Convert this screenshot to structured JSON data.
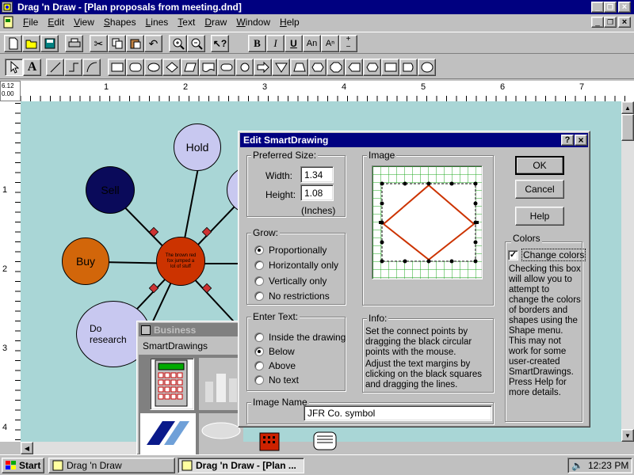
{
  "app_window": {
    "title": "Drag 'n Draw - [Plan proposals from meeting.dnd]"
  },
  "menu": [
    "File",
    "Edit",
    "View",
    "Shapes",
    "Lines",
    "Text",
    "Draw",
    "Window",
    "Help"
  ],
  "text_toolbar": {
    "bold": "B",
    "italic": "I",
    "underline": "U",
    "subscript": "An",
    "superscript": "Aⁿ",
    "plus": "+",
    "minus": "−"
  },
  "ruler": {
    "corner_top": "6.12",
    "corner_bottom": "0.00",
    "h_marks": [
      "1",
      "2",
      "3",
      "4",
      "5",
      "6",
      "7"
    ],
    "v_marks": [
      "1",
      "2",
      "3",
      "4"
    ]
  },
  "diagram": {
    "nodes": [
      {
        "label": "Hold",
        "color": "#c8c8f0"
      },
      {
        "label": "Sell",
        "color": "#0a0a5a"
      },
      {
        "label": "Buy",
        "color": "#d2660a"
      },
      {
        "label": "Do\nresearch",
        "color": "#c8c8f0"
      },
      {
        "label": "The brown red fox jumped a lot of stuff",
        "color": "#cc3300"
      }
    ]
  },
  "dialog": {
    "title": "Edit SmartDrawing",
    "help_glyph": "?",
    "close_glyph": "×",
    "preferred_size": {
      "label": "Preferred Size:",
      "width_label": "Width:",
      "width_value": "1.34",
      "height_label": "Height:",
      "height_value": "1.08",
      "units": "(Inches)"
    },
    "grow": {
      "label": "Grow:",
      "options": [
        "Proportionally",
        "Horizontally only",
        "Vertically only",
        "No restrictions"
      ],
      "selected": "Proportionally"
    },
    "enter_text": {
      "label": "Enter Text:",
      "options": [
        "Inside the drawing",
        "Below",
        "Above",
        "No text"
      ],
      "selected": "Below"
    },
    "image": {
      "label": "Image"
    },
    "info": {
      "label": "Info:",
      "para1": "Set the connect points by dragging the black circular points with the mouse.",
      "para2": "Adjust the text margins by clicking on the black squares and dragging the lines."
    },
    "image_name": {
      "label": "Image Name",
      "value": "JFR Co. symbol"
    },
    "buttons": {
      "ok": "OK",
      "cancel": "Cancel",
      "help": "Help"
    },
    "colors": {
      "label": "Colors",
      "checkbox_label": "Change colors",
      "checked": true,
      "description": "Checking this box will allow you to attempt to change the colors of borders and shapes using the Shape menu. This may not work for some user-created SmartDrawings. Press Help for more details."
    }
  },
  "business_panel": {
    "title": "Business",
    "tab": "SmartDrawings"
  },
  "taskbar": {
    "start": "Start",
    "tasks": [
      "Drag 'n Draw",
      "Drag 'n Draw - [Plan ..."
    ],
    "clock": "12:23 PM"
  }
}
